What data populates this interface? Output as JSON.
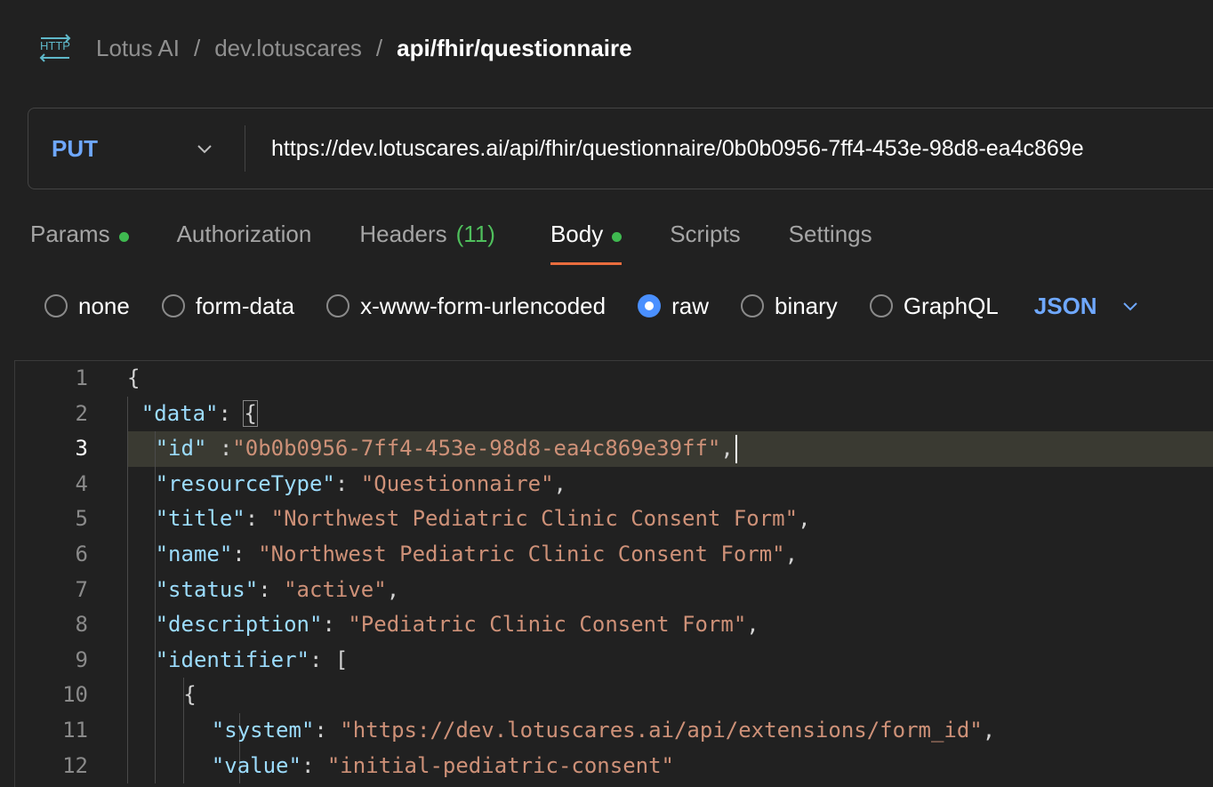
{
  "breadcrumb": {
    "icon": "http-icon",
    "items": [
      "Lotus AI",
      "dev.lotuscares"
    ],
    "separator": "/",
    "current": "api/fhir/questionnaire"
  },
  "request": {
    "method": "PUT",
    "url": "https://dev.lotuscares.ai/api/fhir/questionnaire/0b0b0956-7ff4-453e-98d8-ea4c869e"
  },
  "tabs": [
    {
      "label": "Params",
      "dot": true
    },
    {
      "label": "Authorization"
    },
    {
      "label": "Headers",
      "count": "(11)"
    },
    {
      "label": "Body",
      "dot": true,
      "active": true
    },
    {
      "label": "Scripts"
    },
    {
      "label": "Settings"
    }
  ],
  "body_types": {
    "options": [
      "none",
      "form-data",
      "x-www-form-urlencoded",
      "raw",
      "binary",
      "GraphQL"
    ],
    "selected": "raw",
    "language": "JSON"
  },
  "editor": {
    "active_line": 3,
    "lines": [
      {
        "n": "1",
        "indent": 0,
        "tokens": [
          [
            "punc",
            "{"
          ]
        ]
      },
      {
        "n": "2",
        "indent": 1,
        "tokens": [
          [
            "key",
            "\"data\""
          ],
          [
            "punc",
            ": "
          ],
          [
            "punc",
            "{"
          ]
        ]
      },
      {
        "n": "3",
        "indent": 2,
        "tokens": [
          [
            "key",
            "\"id\""
          ],
          [
            "punc",
            " :"
          ],
          [
            "str",
            "\"0b0b0956-7ff4-453e-98d8-ea4c869e39ff\""
          ],
          [
            "punc",
            ","
          ]
        ]
      },
      {
        "n": "4",
        "indent": 2,
        "tokens": [
          [
            "key",
            "\"resourceType\""
          ],
          [
            "punc",
            ": "
          ],
          [
            "str",
            "\"Questionnaire\""
          ],
          [
            "punc",
            ","
          ]
        ]
      },
      {
        "n": "5",
        "indent": 2,
        "tokens": [
          [
            "key",
            "\"title\""
          ],
          [
            "punc",
            ": "
          ],
          [
            "str",
            "\"Northwest Pediatric Clinic Consent Form\""
          ],
          [
            "punc",
            ","
          ]
        ]
      },
      {
        "n": "6",
        "indent": 2,
        "tokens": [
          [
            "key",
            "\"name\""
          ],
          [
            "punc",
            ": "
          ],
          [
            "str",
            "\"Northwest Pediatric Clinic Consent Form\""
          ],
          [
            "punc",
            ","
          ]
        ]
      },
      {
        "n": "7",
        "indent": 2,
        "tokens": [
          [
            "key",
            "\"status\""
          ],
          [
            "punc",
            ": "
          ],
          [
            "str",
            "\"active\""
          ],
          [
            "punc",
            ","
          ]
        ]
      },
      {
        "n": "8",
        "indent": 2,
        "tokens": [
          [
            "key",
            "\"description\""
          ],
          [
            "punc",
            ": "
          ],
          [
            "str",
            "\"Pediatric Clinic Consent Form\""
          ],
          [
            "punc",
            ","
          ]
        ]
      },
      {
        "n": "9",
        "indent": 2,
        "tokens": [
          [
            "key",
            "\"identifier\""
          ],
          [
            "punc",
            ": "
          ],
          [
            "punc",
            "["
          ]
        ]
      },
      {
        "n": "10",
        "indent": 4,
        "tokens": [
          [
            "punc",
            "{"
          ]
        ]
      },
      {
        "n": "11",
        "indent": 6,
        "tokens": [
          [
            "key",
            "\"system\""
          ],
          [
            "punc",
            ": "
          ],
          [
            "str",
            "\"https://dev.lotuscares.ai/api/extensions/form_id\""
          ],
          [
            "punc",
            ","
          ]
        ]
      },
      {
        "n": "12",
        "indent": 6,
        "tokens": [
          [
            "key",
            "\"value\""
          ],
          [
            "punc",
            ": "
          ],
          [
            "str",
            "\"initial-pediatric-consent\""
          ]
        ]
      }
    ]
  },
  "colors": {
    "accent_blue": "#6fa8ff",
    "tab_underline": "#ea6d3e",
    "dot_green": "#3fb950",
    "json_key": "#9cdcfe",
    "json_string": "#ce9178"
  }
}
